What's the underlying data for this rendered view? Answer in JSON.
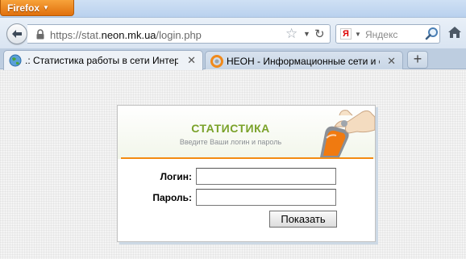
{
  "browser": {
    "menu_button_label": "Firefox",
    "url": {
      "prefix": "https://stat.",
      "domain": "neon.mk.ua",
      "path": "/login.php"
    },
    "search_placeholder": "Яндекс",
    "search_engine_icon": "yandex-icon"
  },
  "tabs": [
    {
      "label": ".: Статистика работы в сети Интерне...",
      "icon": "globe-icon",
      "active": true
    },
    {
      "label": "НЕОН - Информационные сети и систе...",
      "icon": "neon-icon",
      "active": false
    }
  ],
  "login": {
    "title": "СТАТИСТИКА",
    "subtitle": "Введите Ваши логин и пароль",
    "login_label": "Логин:",
    "login_value": "",
    "password_label": "Пароль:",
    "password_value": "",
    "submit_label": "Показать"
  },
  "colors": {
    "title_green": "#7aa22a",
    "orange_accent": "#f38b12",
    "firefox_orange": "#e0700d"
  }
}
